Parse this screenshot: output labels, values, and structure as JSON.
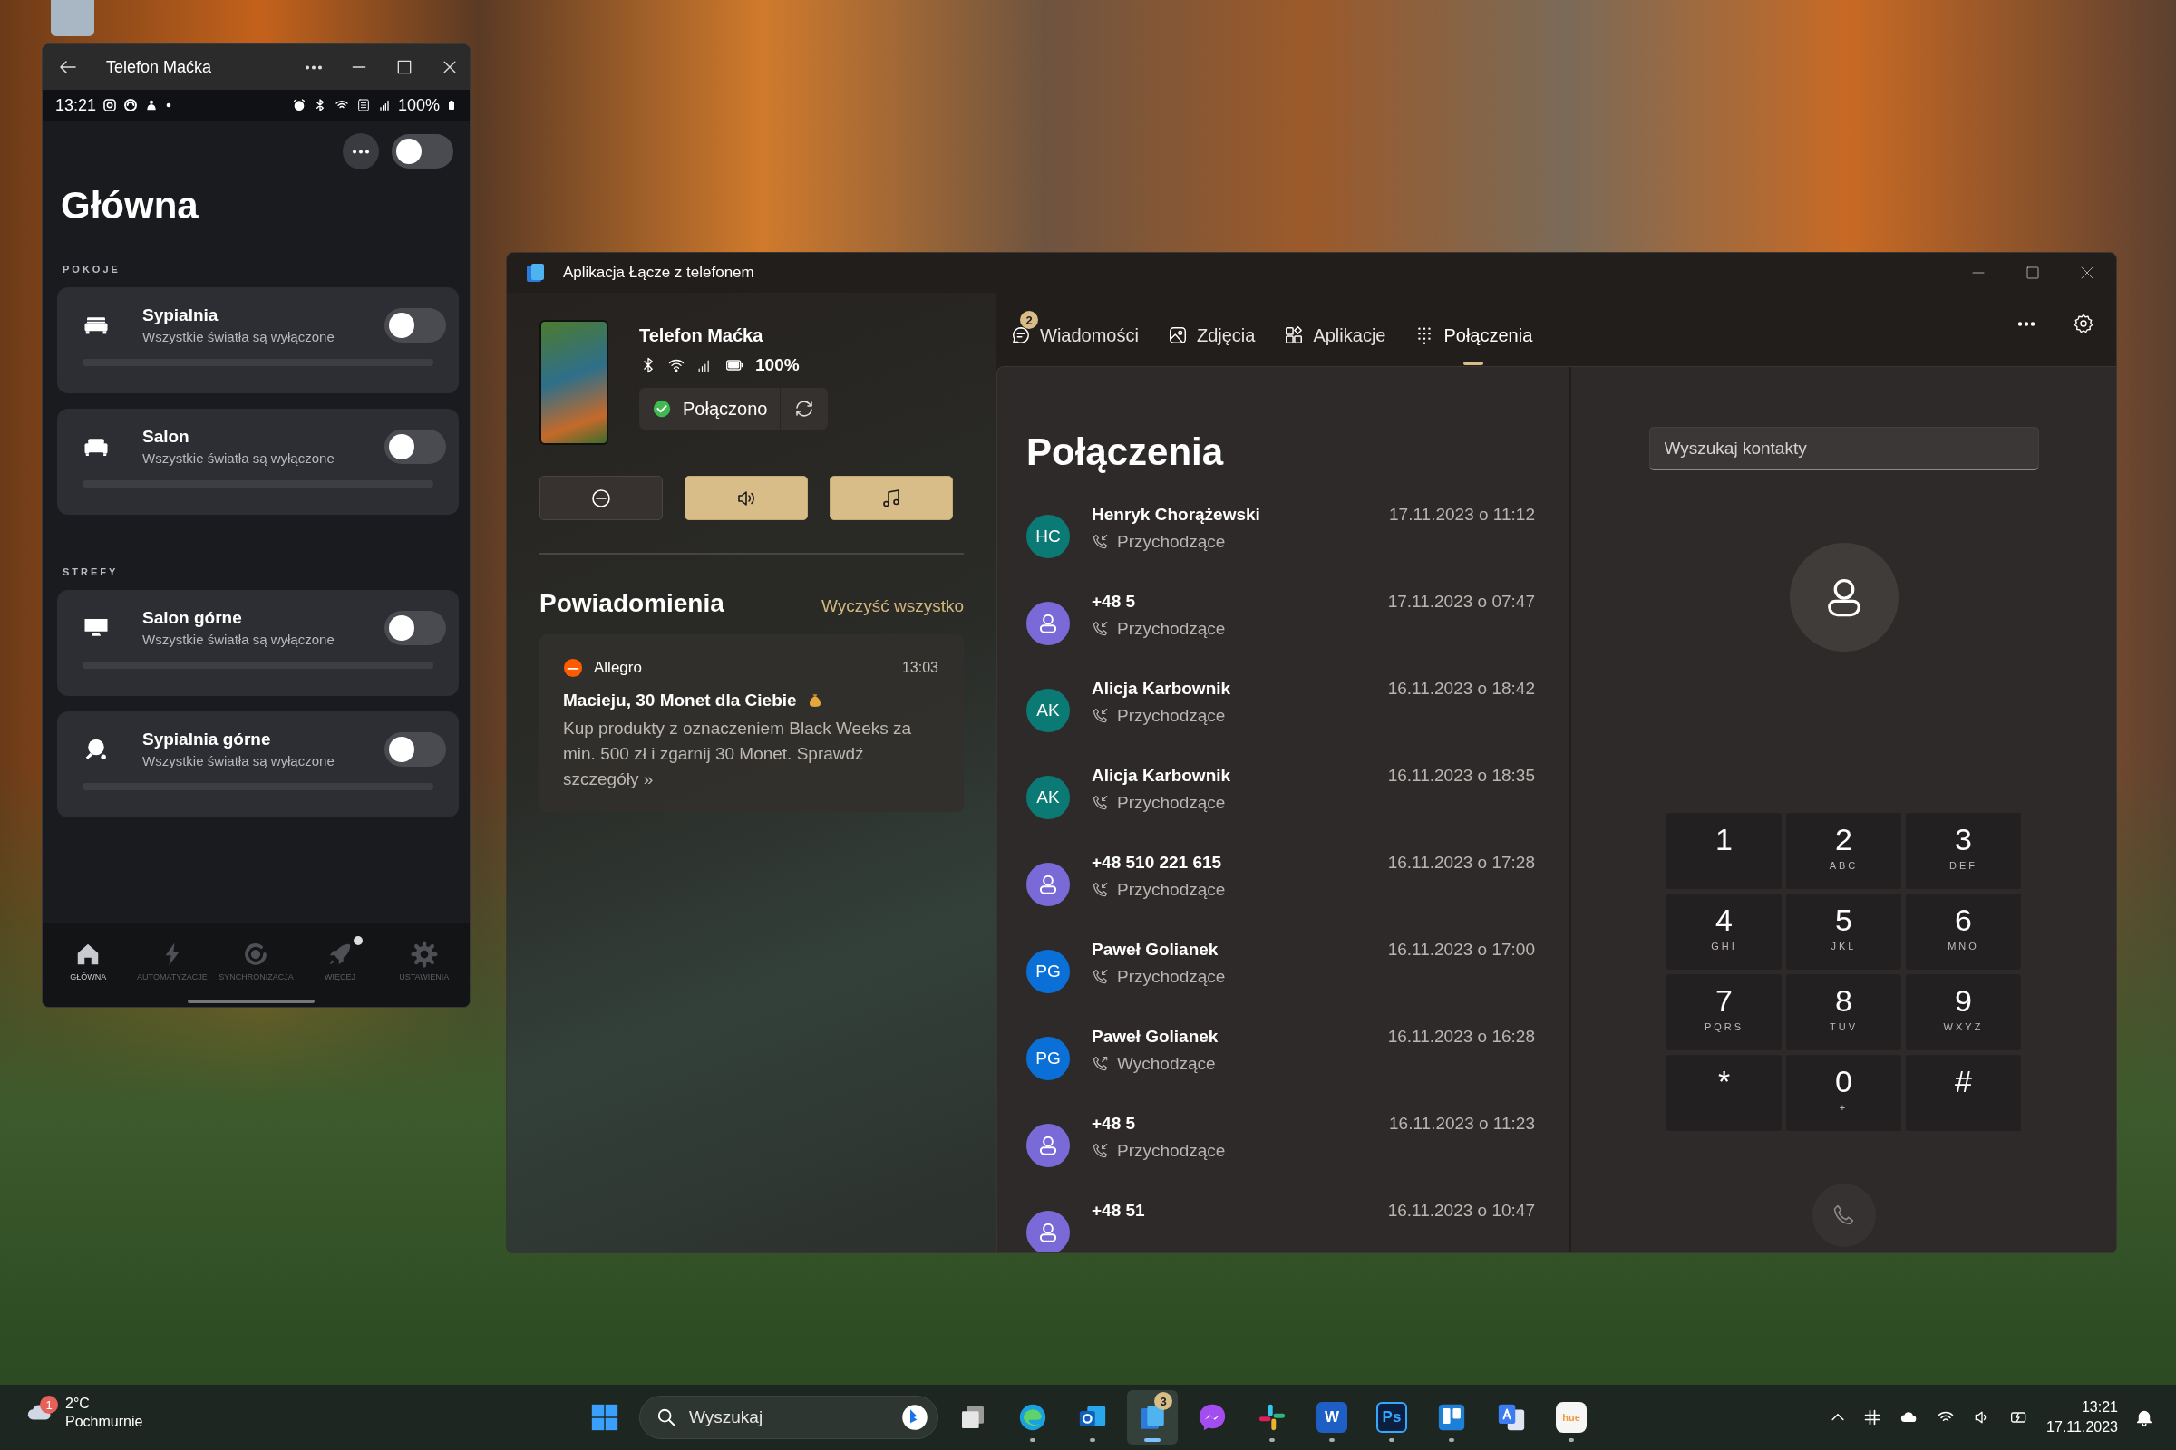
{
  "phone_window": {
    "title": "Telefon Maćka",
    "status_bar": {
      "time": "13:21",
      "battery": "100%"
    },
    "master_toggle": {
      "on": false
    },
    "page_title": "Główna",
    "sections": [
      {
        "heading": "POKOJE",
        "items": [
          {
            "name": "Sypialnia",
            "status": "Wszystkie światła są wyłączone",
            "on": false,
            "kind": "bed"
          },
          {
            "name": "Salon",
            "status": "Wszystkie światła są wyłączone",
            "on": false,
            "kind": "sofa"
          }
        ]
      },
      {
        "heading": "STREFY",
        "items": [
          {
            "name": "Salon górne",
            "status": "Wszystkie światła są wyłączone",
            "on": false,
            "kind": "monitor"
          },
          {
            "name": "Sypialnia górne",
            "status": "Wszystkie światła są wyłączone",
            "on": false,
            "kind": "paddle"
          }
        ]
      }
    ],
    "nav": [
      {
        "label": "GŁÓWNA",
        "selected": true,
        "kind": "home",
        "dot": false
      },
      {
        "label": "AUTOMATYZACJE",
        "selected": false,
        "kind": "bolt",
        "dot": false
      },
      {
        "label": "SYNCHRONIZACJA",
        "selected": false,
        "kind": "sync",
        "dot": false
      },
      {
        "label": "WIĘCEJ",
        "selected": false,
        "kind": "rocket",
        "dot": true
      },
      {
        "label": "USTAWIENIA",
        "selected": false,
        "kind": "gear",
        "dot": false
      }
    ]
  },
  "phone_link": {
    "title": "Aplikacja Łącze z telefonem",
    "device": {
      "name": "Telefon Maćka",
      "battery": "100%",
      "status": "Połączono"
    },
    "quick_actions": [
      {
        "kind": "do-not-disturb",
        "on": false
      },
      {
        "kind": "volume",
        "on": true
      },
      {
        "kind": "music",
        "on": true
      }
    ],
    "notifications": {
      "heading": "Powiadomienia",
      "clear": "Wyczyść wszystko",
      "items": [
        {
          "app": "Allegro",
          "time": "13:03",
          "title": "Macieju, 30 Monet dla Ciebie",
          "body": "Kup produkty z oznaczeniem Black Weeks za min. 500 zł i zgarnij 30 Monet. Sprawdź szczegóły »"
        }
      ]
    },
    "tabs": [
      {
        "label": "Wiadomości",
        "kind": "messages",
        "selected": false,
        "badge": "2"
      },
      {
        "label": "Zdjęcia",
        "kind": "photos",
        "selected": false
      },
      {
        "label": "Aplikacje",
        "kind": "apps",
        "selected": false
      },
      {
        "label": "Połączenia",
        "kind": "calls",
        "selected": true
      }
    ],
    "calls": {
      "heading": "Połączenia",
      "items": [
        {
          "name": "Henryk Chorążewski",
          "initials": "HC",
          "color": "#0b7a75",
          "direction": "Przychodzące",
          "kind": "incoming",
          "time": "17.11.2023 o 11:12"
        },
        {
          "name": "+48 5",
          "color": "#7a6ad8",
          "direction": "Przychodzące",
          "kind": "incoming",
          "time": "17.11.2023 o 07:47"
        },
        {
          "name": "Alicja Karbownik",
          "initials": "AK",
          "color": "#0b7a75",
          "direction": "Przychodzące",
          "kind": "incoming",
          "time": "16.11.2023 o 18:42"
        },
        {
          "name": "Alicja Karbownik",
          "initials": "AK",
          "color": "#0b7a75",
          "direction": "Przychodzące",
          "kind": "incoming",
          "time": "16.11.2023 o 18:35"
        },
        {
          "name": "+48 510 221 615",
          "color": "#7a6ad8",
          "direction": "Przychodzące",
          "kind": "incoming",
          "time": "16.11.2023 o 17:28"
        },
        {
          "name": "Paweł Golianek",
          "initials": "PG",
          "color": "#0a6fd6",
          "direction": "Przychodzące",
          "kind": "incoming",
          "time": "16.11.2023 o 17:00"
        },
        {
          "name": "Paweł Golianek",
          "initials": "PG",
          "color": "#0a6fd6",
          "direction": "Wychodzące",
          "kind": "outgoing",
          "time": "16.11.2023 o 16:28"
        },
        {
          "name": "+48 5",
          "color": "#7a6ad8",
          "direction": "Przychodzące",
          "kind": "incoming",
          "time": "16.11.2023 o 11:23"
        },
        {
          "name": "+48 51",
          "color": "#7a6ad8",
          "time": "16.11.2023 o 10:47"
        }
      ]
    },
    "dialer": {
      "placeholder": "Wyszukaj kontakty",
      "keys": [
        {
          "digit": "1"
        },
        {
          "digit": "2",
          "letters": "ABC"
        },
        {
          "digit": "3",
          "letters": "DEF"
        },
        {
          "digit": "4",
          "letters": "GHI"
        },
        {
          "digit": "5",
          "letters": "JKL"
        },
        {
          "digit": "6",
          "letters": "MNO"
        },
        {
          "digit": "7",
          "letters": "PQRS"
        },
        {
          "digit": "8",
          "letters": "TUV"
        },
        {
          "digit": "9",
          "letters": "WXYZ"
        },
        {
          "digit": "*"
        },
        {
          "digit": "0",
          "letters": "+"
        },
        {
          "digit": "#"
        }
      ]
    }
  },
  "taskbar": {
    "weather": {
      "temperature": "2°C",
      "condition": "Pochmurnie",
      "badge": "1"
    },
    "search": {
      "placeholder": "Wyszukaj"
    },
    "apps": [
      {
        "kind": "start",
        "running": false,
        "selected": false
      },
      {
        "kind": "task-view",
        "running": false,
        "selected": false
      },
      {
        "kind": "edge",
        "running": true,
        "selected": false
      },
      {
        "kind": "outlook",
        "running": true,
        "selected": false
      },
      {
        "kind": "phone-link",
        "running": true,
        "selected": true,
        "badge": "3"
      },
      {
        "kind": "messenger",
        "running": false,
        "selected": false
      },
      {
        "kind": "slack",
        "running": true,
        "selected": false
      },
      {
        "kind": "word",
        "running": true,
        "selected": false,
        "glyph": "W"
      },
      {
        "kind": "photoshop",
        "running": true,
        "selected": false,
        "glyph": "Ps"
      },
      {
        "kind": "trello",
        "running": true,
        "selected": false
      },
      {
        "kind": "translate",
        "running": false,
        "selected": false
      },
      {
        "kind": "hue",
        "running": true,
        "selected": false,
        "glyph": "hue"
      }
    ],
    "clock": {
      "time": "13:21",
      "date": "17.11.2023"
    }
  }
}
